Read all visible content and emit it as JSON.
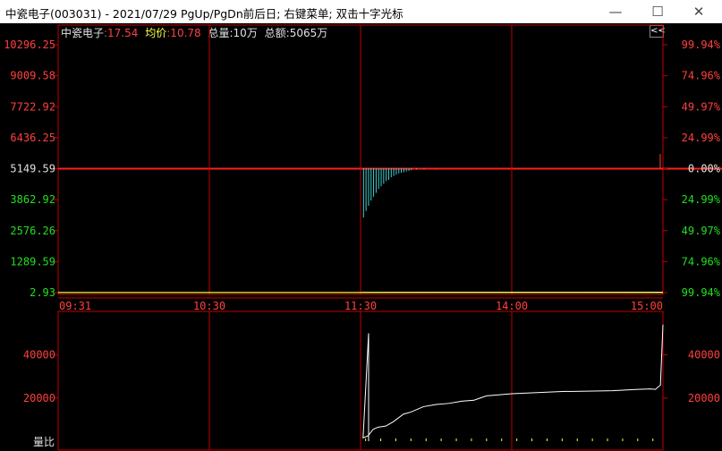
{
  "window": {
    "title": "中瓷电子(003031) - 2021/07/29 PgUp/PgDn前后日; 右键菜单; 双击十字光标",
    "minimize_glyph": "—",
    "maximize_glyph": "☐",
    "close_glyph": "✕"
  },
  "info": {
    "name": "中瓷电子",
    "price": ":17.54",
    "avg_label": "均价",
    "avg_value": ":10.78",
    "volume": "总量:10万",
    "amount": "总额:5065万",
    "collapse_glyph": "<<"
  },
  "colors": {
    "up": "#ff4040",
    "down": "#20e020",
    "neutral": "#e0e0e0",
    "grid": "#c00000",
    "avg": "#ffff40",
    "price_line": "#ffffff",
    "neg_bar": "#40d0d0"
  },
  "chart_data": [
    {
      "type": "line",
      "title": "",
      "price_ticks": [
        "10296.25",
        "9009.58",
        "7722.92",
        "6436.25",
        "5149.59",
        "3862.92",
        "2576.26",
        "1289.59",
        "2.93"
      ],
      "pct_ticks": [
        "99.94%",
        "74.96%",
        "49.97%",
        "24.99%",
        "0.00%",
        "24.99%",
        "49.97%",
        "74.96%",
        "99.94%"
      ],
      "time_ticks": [
        "09:31",
        "10:30",
        "11:30",
        "14:00",
        "15:00"
      ],
      "ylim": [
        2.93,
        10296.25
      ],
      "prev_close": 5149.59,
      "series": [
        {
          "name": "price",
          "x": [
            0,
            60,
            120,
            121,
            150,
            200,
            240
          ],
          "values": [
            5.2,
            5.0,
            4.8,
            10.5,
            12.5,
            15.0,
            17.54
          ]
        },
        {
          "name": "均价",
          "x": [
            0,
            60,
            120,
            121,
            150,
            200,
            240
          ],
          "values": [
            5.0,
            5.0,
            5.0,
            8.5,
            9.8,
            10.4,
            10.78
          ]
        }
      ],
      "neg_bars": {
        "x": [
          121,
          122,
          123,
          124,
          125,
          126,
          127,
          128,
          129,
          130,
          131,
          132,
          133,
          134,
          135,
          136,
          137,
          138,
          139,
          140,
          142,
          145,
          150
        ],
        "values": [
          -38,
          -33,
          -29,
          -25,
          -22,
          -19,
          -16,
          -14,
          -12,
          -10,
          -9,
          -7,
          -6,
          -5,
          -4,
          -3.5,
          -3,
          -2.5,
          -2,
          -1.5,
          -1,
          -0.6,
          -0.3
        ]
      },
      "pos_bar": {
        "x": 240,
        "value": 10
      }
    },
    {
      "type": "line",
      "title": "",
      "ylabel": "量比",
      "volume_ticks": [
        "40000",
        "20000"
      ],
      "ylim": [
        0,
        56000
      ],
      "series": [
        {
          "name": "量比",
          "x": [
            120,
            121,
            123,
            125,
            127,
            130,
            133,
            137,
            140,
            145,
            150,
            155,
            160,
            165,
            170,
            180,
            190,
            200,
            210,
            220,
            230,
            235,
            237,
            239,
            240
          ],
          "values": [
            50000,
            1500,
            2500,
            5500,
            6500,
            7000,
            9000,
            12500,
            13500,
            16000,
            17000,
            17500,
            18500,
            19000,
            21000,
            22000,
            22500,
            23000,
            23200,
            23400,
            24000,
            24200,
            24000,
            26000,
            54000
          ]
        }
      ]
    }
  ]
}
